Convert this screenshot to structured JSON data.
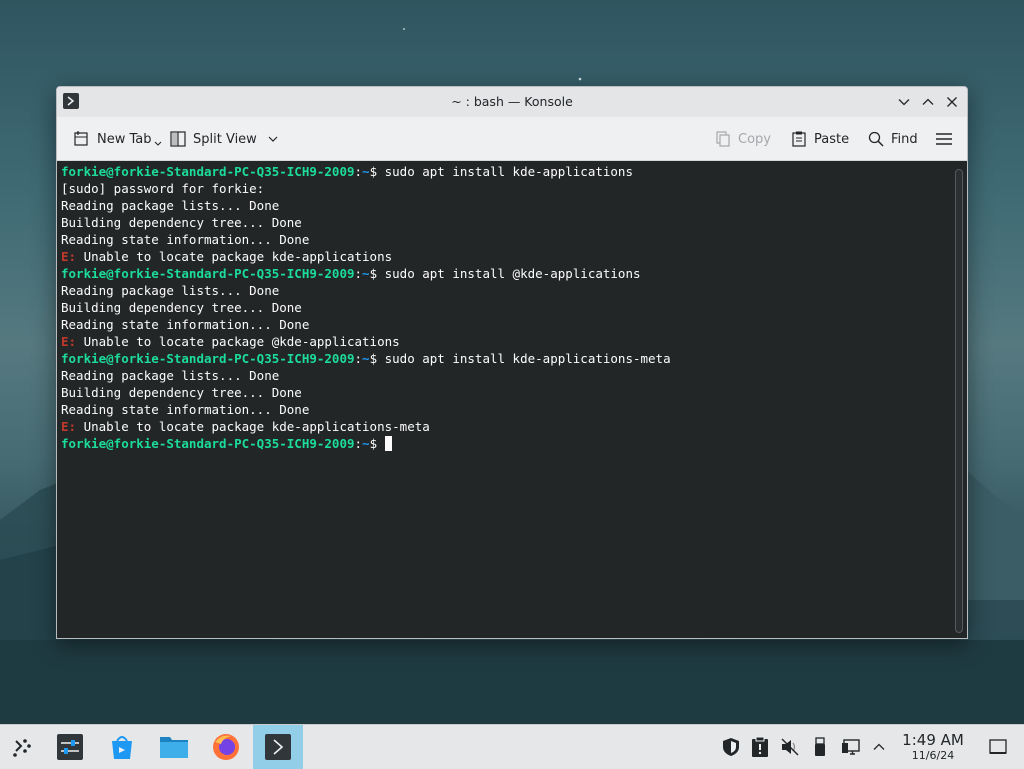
{
  "window": {
    "title": "~ : bash — Konsole"
  },
  "toolbar": {
    "new_tab": "New Tab",
    "split_view": "Split View",
    "copy": "Copy",
    "paste": "Paste",
    "find": "Find"
  },
  "terminal": {
    "prompt_user": "forkie@forkie-Standard-PC-Q35-ICH9-2009",
    "prompt_path": "~",
    "error_prefix": "E:",
    "lines": [
      {
        "kind": "prompt",
        "text": "sudo apt install kde-applications"
      },
      {
        "kind": "out",
        "text": "[sudo] password for forkie:"
      },
      {
        "kind": "out",
        "text": "Reading package lists... Done"
      },
      {
        "kind": "out",
        "text": "Building dependency tree... Done"
      },
      {
        "kind": "out",
        "text": "Reading state information... Done"
      },
      {
        "kind": "err",
        "text": "Unable to locate package kde-applications"
      },
      {
        "kind": "prompt",
        "text": "sudo apt install @kde-applications"
      },
      {
        "kind": "out",
        "text": "Reading package lists... Done"
      },
      {
        "kind": "out",
        "text": "Building dependency tree... Done"
      },
      {
        "kind": "out",
        "text": "Reading state information... Done"
      },
      {
        "kind": "err",
        "text": "Unable to locate package @kde-applications"
      },
      {
        "kind": "prompt",
        "text": "sudo apt install kde-applications-meta"
      },
      {
        "kind": "out",
        "text": "Reading package lists... Done"
      },
      {
        "kind": "out",
        "text": "Building dependency tree... Done"
      },
      {
        "kind": "out",
        "text": "Reading state information... Done"
      },
      {
        "kind": "err",
        "text": "Unable to locate package kde-applications-meta"
      },
      {
        "kind": "prompt",
        "text": "",
        "cursor": true
      }
    ]
  },
  "taskbar": {
    "apps": [
      {
        "icon": "application-launcher-icon"
      },
      {
        "icon": "system-settings-icon"
      },
      {
        "icon": "discover-icon"
      },
      {
        "icon": "dolphin-folder-icon"
      },
      {
        "icon": "firefox-icon"
      },
      {
        "icon": "konsole-icon",
        "active": true
      }
    ],
    "tray": [
      "shield-icon",
      "clipboard-icon",
      "volume-muted-icon",
      "usb-device-icon",
      "network-icon",
      "chevron-up-icon"
    ],
    "time": "1:49 AM",
    "date": "11/6/24"
  },
  "colors": {
    "prompt": "#1cdc9a",
    "path": "#1d99f3",
    "error": "#c0392b",
    "terminal_bg": "#232627",
    "active_task": "#93cee9"
  }
}
